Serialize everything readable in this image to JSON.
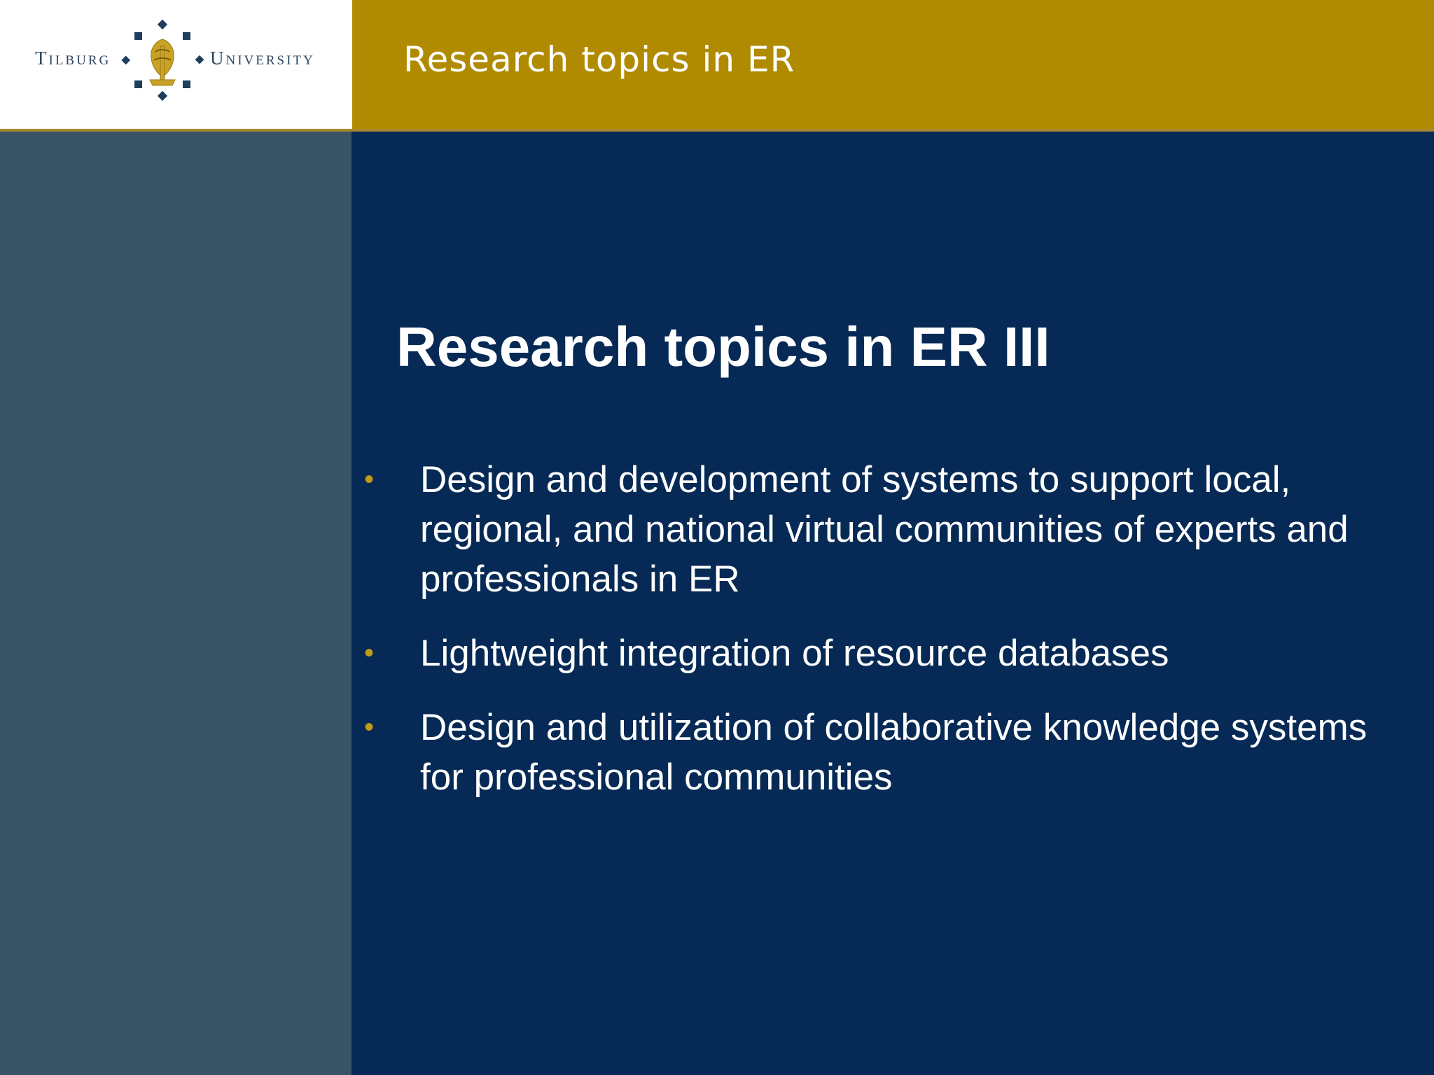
{
  "header": {
    "logo": {
      "left_text": "Tilburg",
      "right_text": "University",
      "emblem_icon": "tilburg-university-seal"
    },
    "title": "Research topics in ER"
  },
  "slide": {
    "title": "Research topics in ER III",
    "bullets": [
      "Design and development of systems to support local, regional, and national virtual communities of experts and professionals in ER",
      "Lightweight integration of resource databases",
      "Design and utilization of collaborative knowledge systems for professional communities"
    ],
    "bullet_marker": "•"
  },
  "colors": {
    "header_gold": "#b08a00",
    "main_navy": "#062a55",
    "side_slate": "#385568",
    "bullet_gold": "#c49a1a",
    "text_white": "#ffffff"
  }
}
